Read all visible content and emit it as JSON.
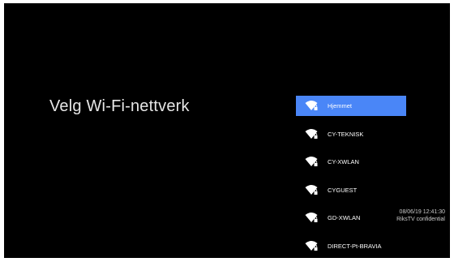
{
  "screen": {
    "title": "Velg Wi-Fi-nettverk"
  },
  "networks": [
    {
      "name": "Hjemmet",
      "selected": true,
      "icon": "wifi-lock-icon"
    },
    {
      "name": "CY-TEKNISK",
      "selected": false,
      "icon": "wifi-lock-icon"
    },
    {
      "name": "CY-XWLAN",
      "selected": false,
      "icon": "wifi-lock-icon"
    },
    {
      "name": "CYGUEST",
      "selected": false,
      "icon": "wifi-lock-icon"
    },
    {
      "name": "GD-XWLAN",
      "selected": false,
      "icon": "wifi-lock-icon"
    },
    {
      "name": "DIRECT-Pt-BRAVIA",
      "selected": false,
      "icon": "wifi-lock-icon"
    }
  ],
  "overlay": {
    "timestamp": "08/06/19 12:41:30",
    "caption": "RiksTV confidential"
  },
  "colors": {
    "background": "#000000",
    "selected": "#4a86f7",
    "text": "#ffffff"
  }
}
